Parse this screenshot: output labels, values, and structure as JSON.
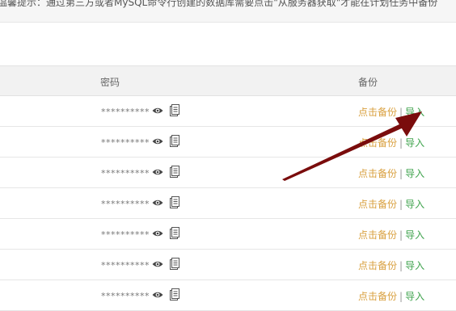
{
  "notice": {
    "text": "温馨提示：通过第三方或者MySQL命令行创建的数据库需要点击\"从服务器获取\"才能在计划任务中备份"
  },
  "table": {
    "headers": {
      "password": "密码",
      "backup": "备份"
    },
    "rows": [
      {
        "password": "**********",
        "backup_label": "点击备份",
        "separator": "|",
        "import_label": "导入"
      },
      {
        "password": "**********",
        "backup_label": "点击备份",
        "separator": "|",
        "import_label": "导入"
      },
      {
        "password": "**********",
        "backup_label": "点击备份",
        "separator": "|",
        "import_label": "导入"
      },
      {
        "password": "**********",
        "backup_label": "点击备份",
        "separator": "|",
        "import_label": "导入"
      },
      {
        "password": "**********",
        "backup_label": "点击备份",
        "separator": "|",
        "import_label": "导入"
      },
      {
        "password": "**********",
        "backup_label": "点击备份",
        "separator": "|",
        "import_label": "导入"
      },
      {
        "password": "**********",
        "backup_label": "点击备份",
        "separator": "|",
        "import_label": "导入"
      }
    ]
  },
  "icons": {
    "view": "eye-icon",
    "copy": "copy-icon"
  },
  "colors": {
    "backup_link": "#d9a03f",
    "import_link": "#3fa34d",
    "annotation_arrow": "#7a0c0c"
  }
}
